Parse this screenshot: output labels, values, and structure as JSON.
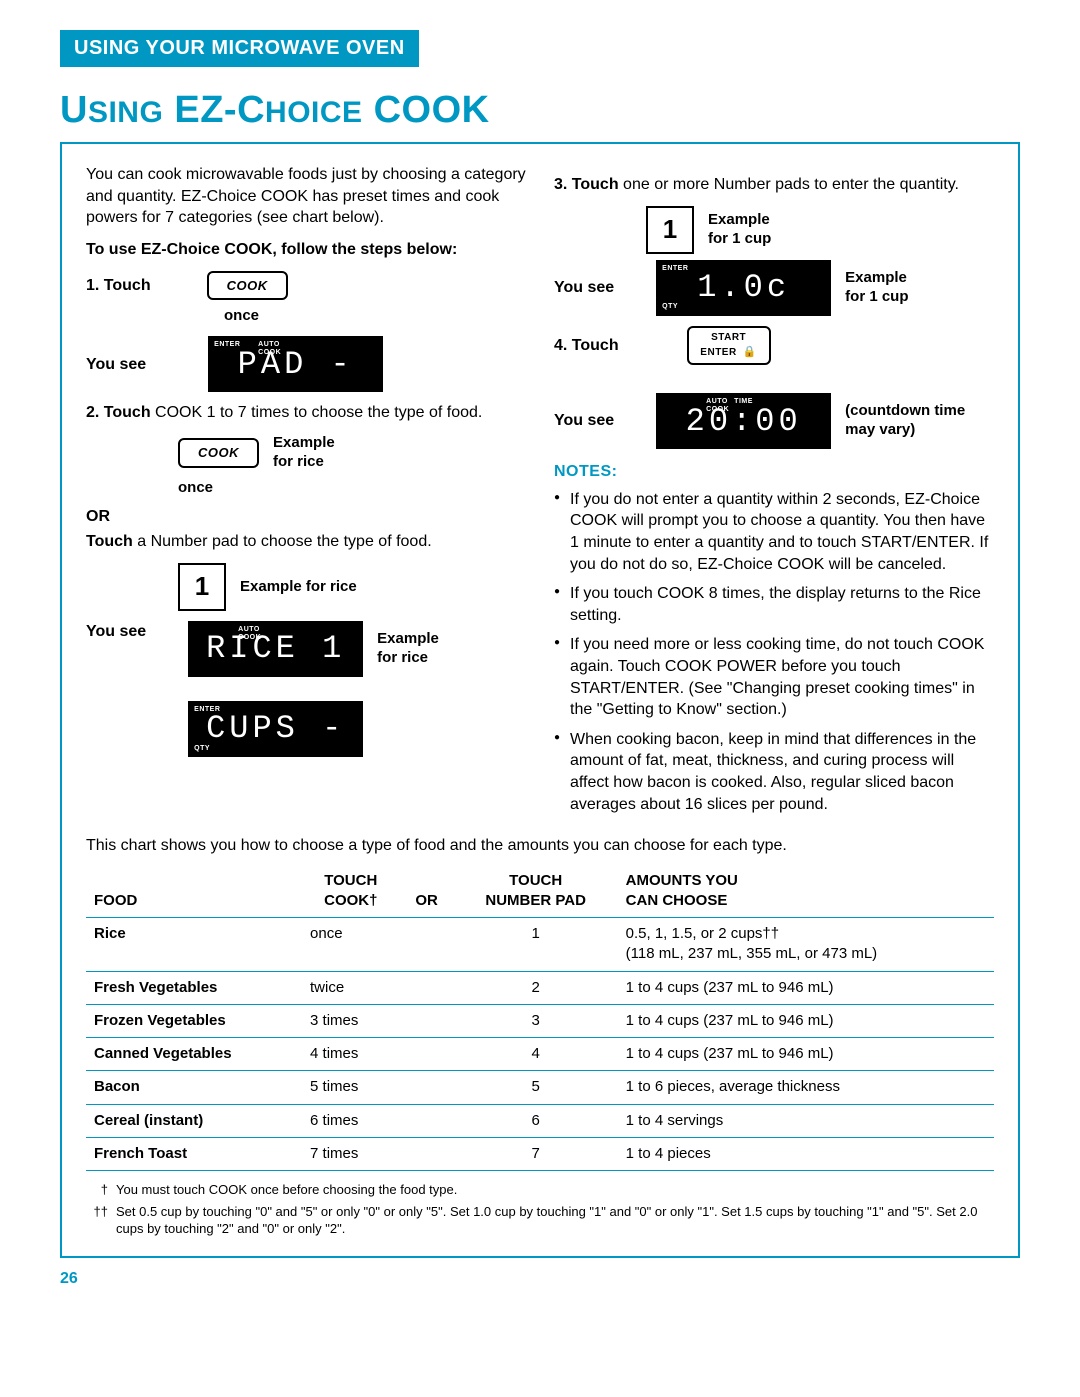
{
  "section_header": "USING YOUR MICROWAVE OVEN",
  "title_a": "U",
  "title_b": "SING",
  "title_c": " EZ-C",
  "title_d": "HOICE",
  "title_e": " COOK",
  "intro": "You can cook microwavable foods just by choosing a category and quantity. EZ-Choice COOK has preset times and cook powers for 7 categories (see chart below).",
  "steps_head": "To use EZ-Choice COOK, follow the steps below:",
  "step1_num": "1.",
  "step1_touch": "Touch",
  "btn_cook": "COOK",
  "once": "once",
  "you_see": "You see",
  "disp_pad": "PAD  -",
  "tag_enter": "ENTER",
  "tag_auto": "AUTO",
  "tag_cook": "COOK",
  "tag_qty": "QTY",
  "step2_num": "2.",
  "step2_a": "Touch",
  "step2_b": " COOK 1 to 7 times to choose the type of food.",
  "example_rice": "Example for rice",
  "or": "OR",
  "step2_alt_a": "Touch",
  "step2_alt_b": " a Number pad to choose the type of food.",
  "num1": "1",
  "disp_rice": "RICE  1",
  "disp_cups": "CUPS -",
  "step3_num": "3.",
  "step3_a": "Touch",
  "step3_b": " one or more Number pads to enter the quantity.",
  "example_1cup": "Example for 1 cup",
  "disp_10c": "1.0c",
  "step4_num": "4.",
  "step4_touch": "Touch",
  "btn_start": "START",
  "btn_enter": "ENTER",
  "disp_2000": "20:00",
  "tag_time": "TIME",
  "countdown_a": "(countdown time",
  "countdown_b": "may vary)",
  "notes_head": "NOTES:",
  "notes": [
    "If you do not enter a quantity within 2 seconds, EZ-Choice COOK will prompt you to choose a quantity. You then have 1 minute to enter a quantity and to touch START/ENTER. If you do not do so, EZ-Choice COOK will be canceled.",
    "If you touch COOK 8 times, the display returns to the Rice setting.",
    "If you need more or less cooking time, do not touch COOK again. Touch COOK POWER before you touch START/ENTER. (See \"Changing preset cooking times\" in the \"Getting to Know\" section.)",
    "When cooking bacon, keep in mind that differences in the amount of fat, meat, thickness, and curing process will affect how bacon is cooked. Also, regular sliced bacon averages about 16 slices per pound."
  ],
  "chart_intro": "This chart shows you how to choose a type of food and the amounts you can choose for each type.",
  "headers": {
    "food": "FOOD",
    "touch_cook_a": "TOUCH",
    "touch_cook_b": "COOK†",
    "or": "OR",
    "touch_num_a": "TOUCH",
    "touch_num_b": "NUMBER PAD",
    "amounts_a": "AMOUNTS YOU",
    "amounts_b": "CAN CHOOSE"
  },
  "rows": [
    {
      "food": "Rice",
      "cook": "once",
      "num": "1",
      "amt": "0.5, 1, 1.5, or 2 cups††\n(118 mL, 237 mL, 355 mL, or 473 mL)"
    },
    {
      "food": "Fresh Vegetables",
      "cook": "twice",
      "num": "2",
      "amt": "1 to 4 cups (237 mL to 946 mL)"
    },
    {
      "food": "Frozen Vegetables",
      "cook": "3 times",
      "num": "3",
      "amt": "1 to 4 cups (237 mL to 946 mL)"
    },
    {
      "food": "Canned Vegetables",
      "cook": "4 times",
      "num": "4",
      "amt": "1 to 4 cups (237 mL to 946 mL)"
    },
    {
      "food": "Bacon",
      "cook": "5 times",
      "num": "5",
      "amt": "1 to 6 pieces, average thickness"
    },
    {
      "food": "Cereal (instant)",
      "cook": "6 times",
      "num": "6",
      "amt": "1 to 4 servings"
    },
    {
      "food": "French Toast",
      "cook": "7 times",
      "num": "7",
      "amt": "1 to 4 pieces"
    }
  ],
  "fn1_mark": "†",
  "fn1": "You must touch COOK once before choosing the food type.",
  "fn2_mark": "††",
  "fn2": "Set 0.5 cup by touching \"0\" and \"5\" or only \"0\" or only \"5\". Set 1.0 cup by touching \"1\" and \"0\" or only \"1\". Set 1.5 cups by touching \"1\" and \"5\". Set 2.0 cups by touching \"2\" and \"0\" or only \"2\".",
  "page_num": "26"
}
